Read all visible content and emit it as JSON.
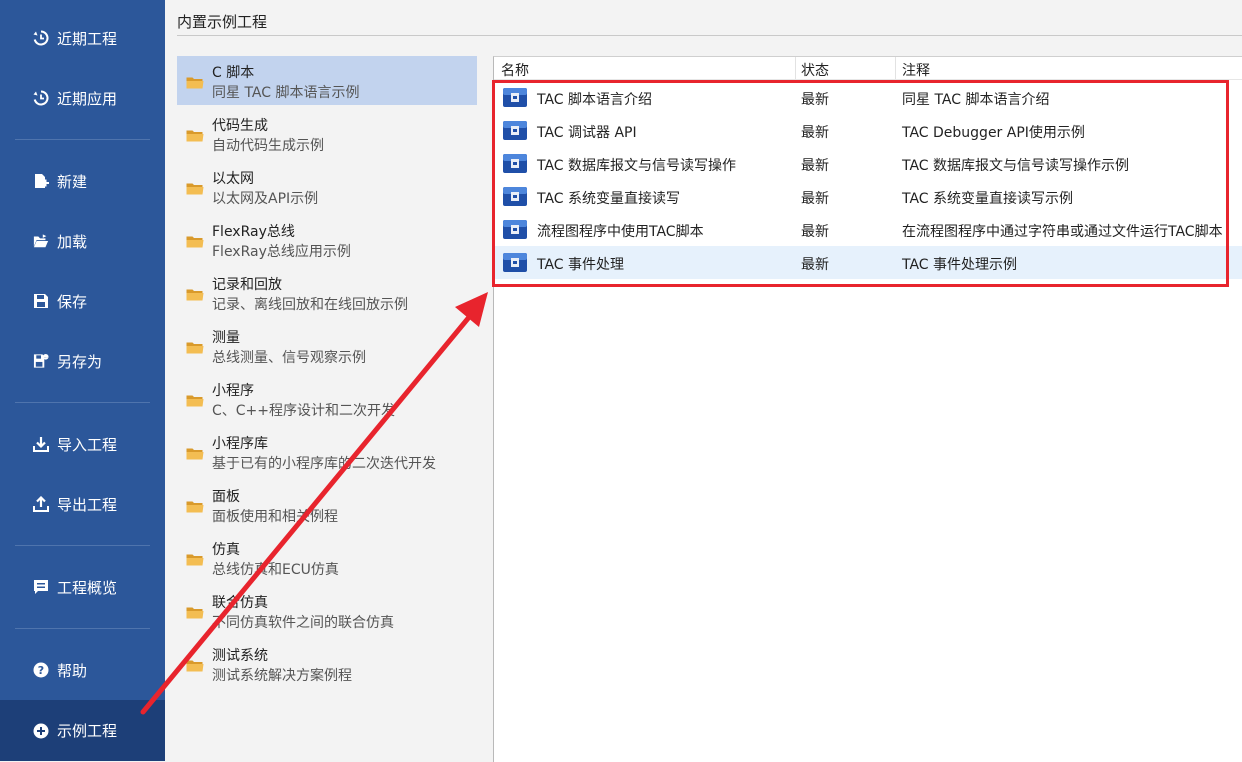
{
  "sidebar": {
    "items": [
      {
        "label": "近期工程",
        "icon": "history-icon"
      },
      {
        "label": "近期应用",
        "icon": "history-icon"
      },
      {
        "label": "新建",
        "icon": "new-file-icon"
      },
      {
        "label": "加载",
        "icon": "folder-open-icon"
      },
      {
        "label": "保存",
        "icon": "save-icon"
      },
      {
        "label": "另存为",
        "icon": "save-as-icon"
      },
      {
        "label": "导入工程",
        "icon": "import-icon"
      },
      {
        "label": "导出工程",
        "icon": "export-icon"
      },
      {
        "label": "工程概览",
        "icon": "overview-icon"
      },
      {
        "label": "帮助",
        "icon": "help-icon"
      },
      {
        "label": "示例工程",
        "icon": "add-circle-icon"
      }
    ],
    "active": "示例工程"
  },
  "main": {
    "title": "内置示例工程",
    "categories": [
      {
        "title": "C 脚本",
        "subtitle": "同星 TAC 脚本语言示例"
      },
      {
        "title": "代码生成",
        "subtitle": "自动代码生成示例"
      },
      {
        "title": "以太网",
        "subtitle": "以太网及API示例"
      },
      {
        "title": "FlexRay总线",
        "subtitle": "FlexRay总线应用示例"
      },
      {
        "title": "记录和回放",
        "subtitle": "记录、离线回放和在线回放示例"
      },
      {
        "title": "测量",
        "subtitle": "总线测量、信号观察示例"
      },
      {
        "title": "小程序",
        "subtitle": "C、C++程序设计和二次开发"
      },
      {
        "title": "小程序库",
        "subtitle": "基于已有的小程序库的二次迭代开发"
      },
      {
        "title": "面板",
        "subtitle": "面板使用和相关例程"
      },
      {
        "title": "仿真",
        "subtitle": "总线仿真和ECU仿真"
      },
      {
        "title": "联合仿真",
        "subtitle": "不同仿真软件之间的联合仿真"
      },
      {
        "title": "测试系统",
        "subtitle": "测试系统解决方案例程"
      }
    ],
    "table": {
      "headers": {
        "name": "名称",
        "status": "状态",
        "note": "注释"
      },
      "rows": [
        {
          "name": "TAC 脚本语言介绍",
          "status": "最新",
          "note": "同星 TAC 脚本语言介绍"
        },
        {
          "name": "TAC 调试器 API",
          "status": "最新",
          "note": "TAC Debugger API使用示例"
        },
        {
          "name": "TAC 数据库报文与信号读写操作",
          "status": "最新",
          "note": "TAC 数据库报文与信号读写操作示例"
        },
        {
          "name": "TAC 系统变量直接读写",
          "status": "最新",
          "note": "TAC 系统变量直接读写示例"
        },
        {
          "name": "流程图程序中使用TAC脚本",
          "status": "最新",
          "note": "在流程图程序中通过字符串或通过文件运行TAC脚本"
        },
        {
          "name": "TAC 事件处理",
          "status": "最新",
          "note": "TAC 事件处理示例"
        }
      ]
    }
  },
  "annotation": {
    "color": "#e8242d"
  }
}
